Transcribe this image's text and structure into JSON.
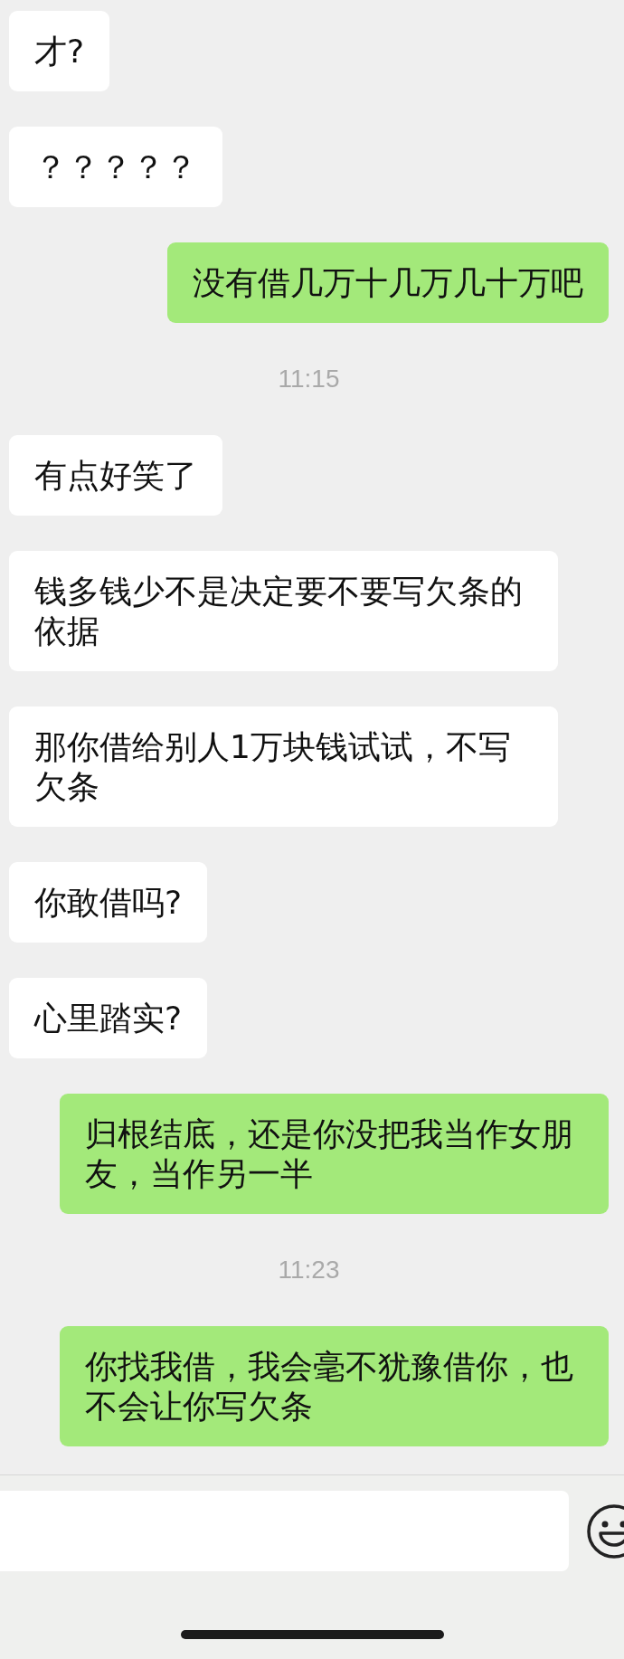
{
  "messages": [
    {
      "kind": "incoming",
      "text": "才?"
    },
    {
      "kind": "incoming",
      "text": "？？？？？"
    },
    {
      "kind": "outgoing",
      "text": "没有借几万十几万几十万吧"
    },
    {
      "kind": "time",
      "text": "11:15"
    },
    {
      "kind": "incoming",
      "text": "有点好笑了"
    },
    {
      "kind": "incoming",
      "text": "钱多钱少不是决定要不要写欠条的依据"
    },
    {
      "kind": "incoming",
      "text": "那你借给别人1万块钱试试，不写欠条"
    },
    {
      "kind": "incoming",
      "text": "你敢借吗?"
    },
    {
      "kind": "incoming",
      "text": "心里踏实?"
    },
    {
      "kind": "outgoing",
      "text": "归根结底，还是你没把我当作女朋友，当作另一半"
    },
    {
      "kind": "time",
      "text": "11:23"
    },
    {
      "kind": "outgoing",
      "text": "你找我借，我会毫不犹豫借你，也不会让你写欠条"
    }
  ]
}
